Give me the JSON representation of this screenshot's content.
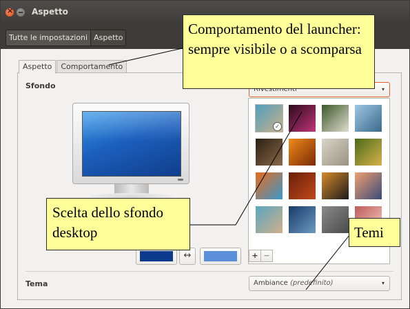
{
  "window": {
    "title": "Aspetto",
    "breadcrumbs": [
      "Tutte le impostazioni",
      "Aspetto"
    ]
  },
  "tabs": [
    "Aspetto",
    "Comportamento"
  ],
  "sfondo": {
    "label": "Sfondo",
    "dropdown_value": "Rivestimenti",
    "add_label": "+",
    "remove_label": "−"
  },
  "tema": {
    "label": "Tema",
    "value": "Ambiance",
    "value_suffix": "(predefinito)"
  },
  "colors": {
    "primary_swatch": "#0d3a8c",
    "secondary_swatch": "#5b8fd8",
    "accent": "#e2622b",
    "callout_bg": "#ffff99"
  },
  "icons": {
    "swap": "↔",
    "dropdown_arrow": "▾",
    "close": "×",
    "selected_check": "✓"
  },
  "callouts": {
    "comportamento": "Comportamento del launcher: sempre visibile o a scomparsa",
    "sfondo": "Scelta dello sfondo desktop",
    "temi": "Temi"
  },
  "wallpapers": [
    {
      "name": "wallpaper-1",
      "c1": "#4f9fbf",
      "c2": "#c9b18a",
      "selected": true
    },
    {
      "name": "wallpaper-2",
      "c1": "#2a0a1a",
      "c2": "#c0357a"
    },
    {
      "name": "wallpaper-3",
      "c1": "#3b5a2a",
      "c2": "#e0dccf"
    },
    {
      "name": "wallpaper-4",
      "c1": "#9fc6e6",
      "c2": "#3a6a8a"
    },
    {
      "name": "wallpaper-5",
      "c1": "#2a1e12",
      "c2": "#8a6a4a"
    },
    {
      "name": "wallpaper-6",
      "c1": "#f08a1a",
      "c2": "#7a2a06"
    },
    {
      "name": "wallpaper-7",
      "c1": "#d8d4c8",
      "c2": "#9a9282"
    },
    {
      "name": "wallpaper-8",
      "c1": "#4a6a1a",
      "c2": "#d8b24a"
    },
    {
      "name": "wallpaper-9",
      "c1": "#e86a1a",
      "c2": "#3a9acf"
    },
    {
      "name": "wallpaper-10",
      "c1": "#6a1e0a",
      "c2": "#c04a1a"
    },
    {
      "name": "wallpaper-11",
      "c1": "#d88a2a",
      "c2": "#1a1a1a"
    },
    {
      "name": "wallpaper-12",
      "c1": "#f0a070",
      "c2": "#3a4a7a"
    },
    {
      "name": "wallpaper-13",
      "c1": "#5aa6c0",
      "c2": "#d0b08a"
    },
    {
      "name": "wallpaper-14",
      "c1": "#1a3a6a",
      "c2": "#6a9ac0"
    },
    {
      "name": "wallpaper-15",
      "c1": "#8a8a8a",
      "c2": "#4a4a4a"
    },
    {
      "name": "wallpaper-16",
      "c1": "#c05a5a",
      "c2": "#f0d0c0"
    }
  ]
}
